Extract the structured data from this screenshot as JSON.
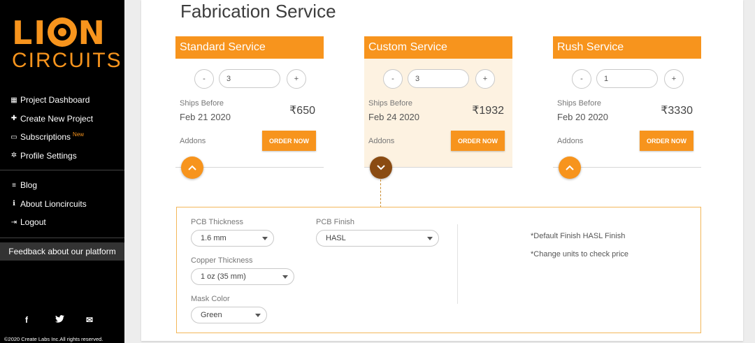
{
  "brand": {
    "logo_top": "LION",
    "logo_bottom": "CIRCUITS"
  },
  "sidebar": {
    "items": [
      {
        "label": "Project Dashboard",
        "icon": "grid-icon",
        "glyph": "▦"
      },
      {
        "label": "Create New Project",
        "icon": "plus-icon",
        "glyph": "✚"
      },
      {
        "label": "Subscriptions",
        "icon": "monitor-icon",
        "glyph": "▭",
        "badge": "New"
      },
      {
        "label": "Profile Settings",
        "icon": "gear-icon",
        "glyph": "✲"
      }
    ],
    "secondary_items": [
      {
        "label": "Blog",
        "icon": "list-icon",
        "glyph": "≡"
      },
      {
        "label": "About Lioncircuits",
        "icon": "info-icon",
        "glyph": "ℹ"
      },
      {
        "label": "Logout",
        "icon": "logout-icon",
        "glyph": "⇥"
      }
    ],
    "feedback_label": "Feedback about our platform",
    "social": [
      {
        "icon": "facebook-icon",
        "glyph": "f"
      },
      {
        "icon": "twitter-icon",
        "glyph": "🐦"
      },
      {
        "icon": "mail-icon",
        "glyph": "✉"
      }
    ],
    "copyright": "©2020 Create Labs Inc.All rights reserved."
  },
  "main": {
    "title": "Fabrication Service",
    "services": [
      {
        "name": "Standard Service",
        "minus": "-",
        "plus": "+",
        "quantity": "3",
        "ships_label": "Ships Before",
        "ship_date": "Feb 21 2020",
        "price": "₹650",
        "addons_label": "Addons",
        "order_label": "ORDER NOW",
        "toggle_glyph": "⌃",
        "highlighted": false,
        "expanded": false
      },
      {
        "name": "Custom Service",
        "minus": "-",
        "plus": "+",
        "quantity": "3",
        "ships_label": "Ships Before",
        "ship_date": "Feb 24 2020",
        "price": "₹1932",
        "addons_label": "Addons",
        "order_label": "ORDER NOW",
        "toggle_glyph": "⌄",
        "highlighted": true,
        "expanded": true
      },
      {
        "name": "Rush Service",
        "minus": "-",
        "plus": "+",
        "quantity": "1",
        "ships_label": "Ships Before",
        "ship_date": "Feb 20 2020",
        "price": "₹3330",
        "addons_label": "Addons",
        "order_label": "ORDER NOW",
        "toggle_glyph": "⌃",
        "highlighted": false,
        "expanded": false
      }
    ],
    "addons_panel": {
      "pcb_thickness": {
        "label": "PCB Thickness",
        "value": "1.6 mm"
      },
      "pcb_finish": {
        "label": "PCB Finish",
        "value": "HASL"
      },
      "copper_thickness": {
        "label": "Copper Thickness",
        "value": "1 oz (35 mm)"
      },
      "mask_color": {
        "label": "Mask Color",
        "value": "Green"
      },
      "notes": [
        "*Default Finish HASL Finish",
        "*Change units to check price"
      ]
    }
  },
  "colors": {
    "accent": "#f7941d",
    "accent_dark": "#8a4b12",
    "highlight_bg": "#fdf2e1",
    "sidebar_bg": "#000000"
  }
}
